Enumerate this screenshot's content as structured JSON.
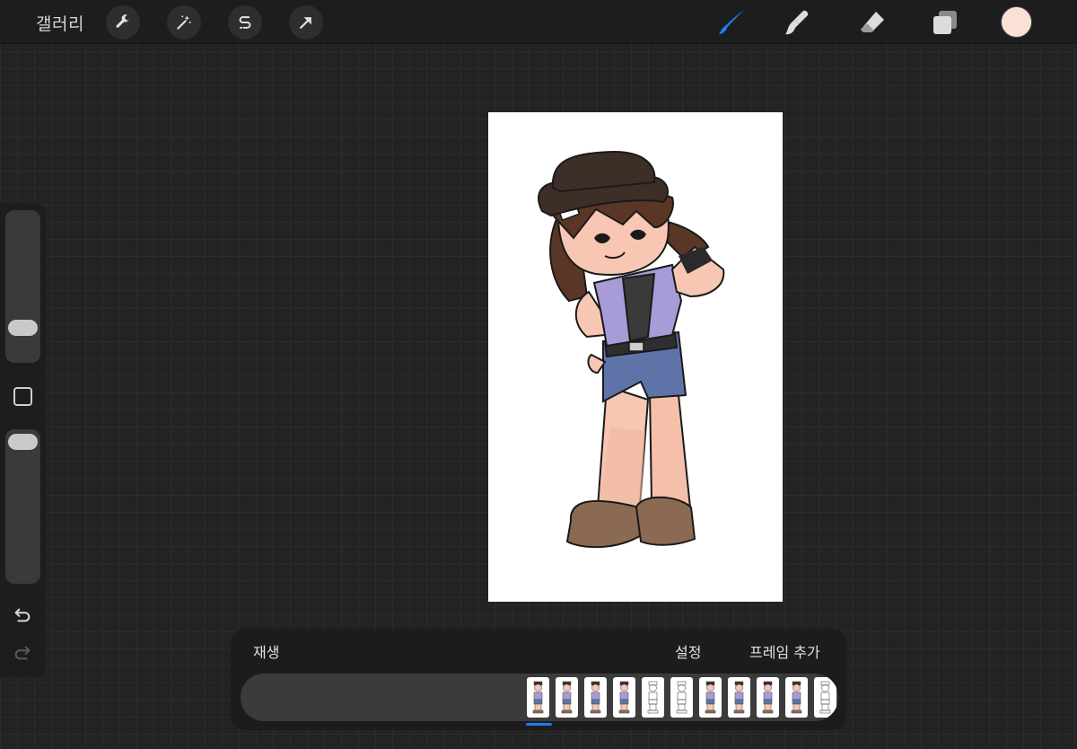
{
  "topbar": {
    "gallery_label": "갤러리",
    "tools_left": [
      "wrench-icon",
      "magic-wand-icon",
      "selection-s-icon",
      "transform-arrow-icon"
    ],
    "tools_right": [
      "brush-icon",
      "smudge-icon",
      "eraser-icon",
      "layers-icon"
    ],
    "active_tool": "brush",
    "accent_color": "#1e7bf2",
    "current_color": "#fbe0d6"
  },
  "sidebar": {
    "tools": [
      "brush-size-slider",
      "modify-button",
      "opacity-slider",
      "undo-icon",
      "redo-icon"
    ]
  },
  "animation": {
    "play_label": "재생",
    "settings_label": "설정",
    "add_frame_label": "프레임 추가",
    "frames": [
      {
        "style": "color"
      },
      {
        "style": "color"
      },
      {
        "style": "color"
      },
      {
        "style": "color"
      },
      {
        "style": "sketch"
      },
      {
        "style": "sketch"
      },
      {
        "style": "color"
      },
      {
        "style": "color"
      },
      {
        "style": "color"
      },
      {
        "style": "color"
      },
      {
        "style": "sketch"
      }
    ],
    "selected_frame": 1
  }
}
